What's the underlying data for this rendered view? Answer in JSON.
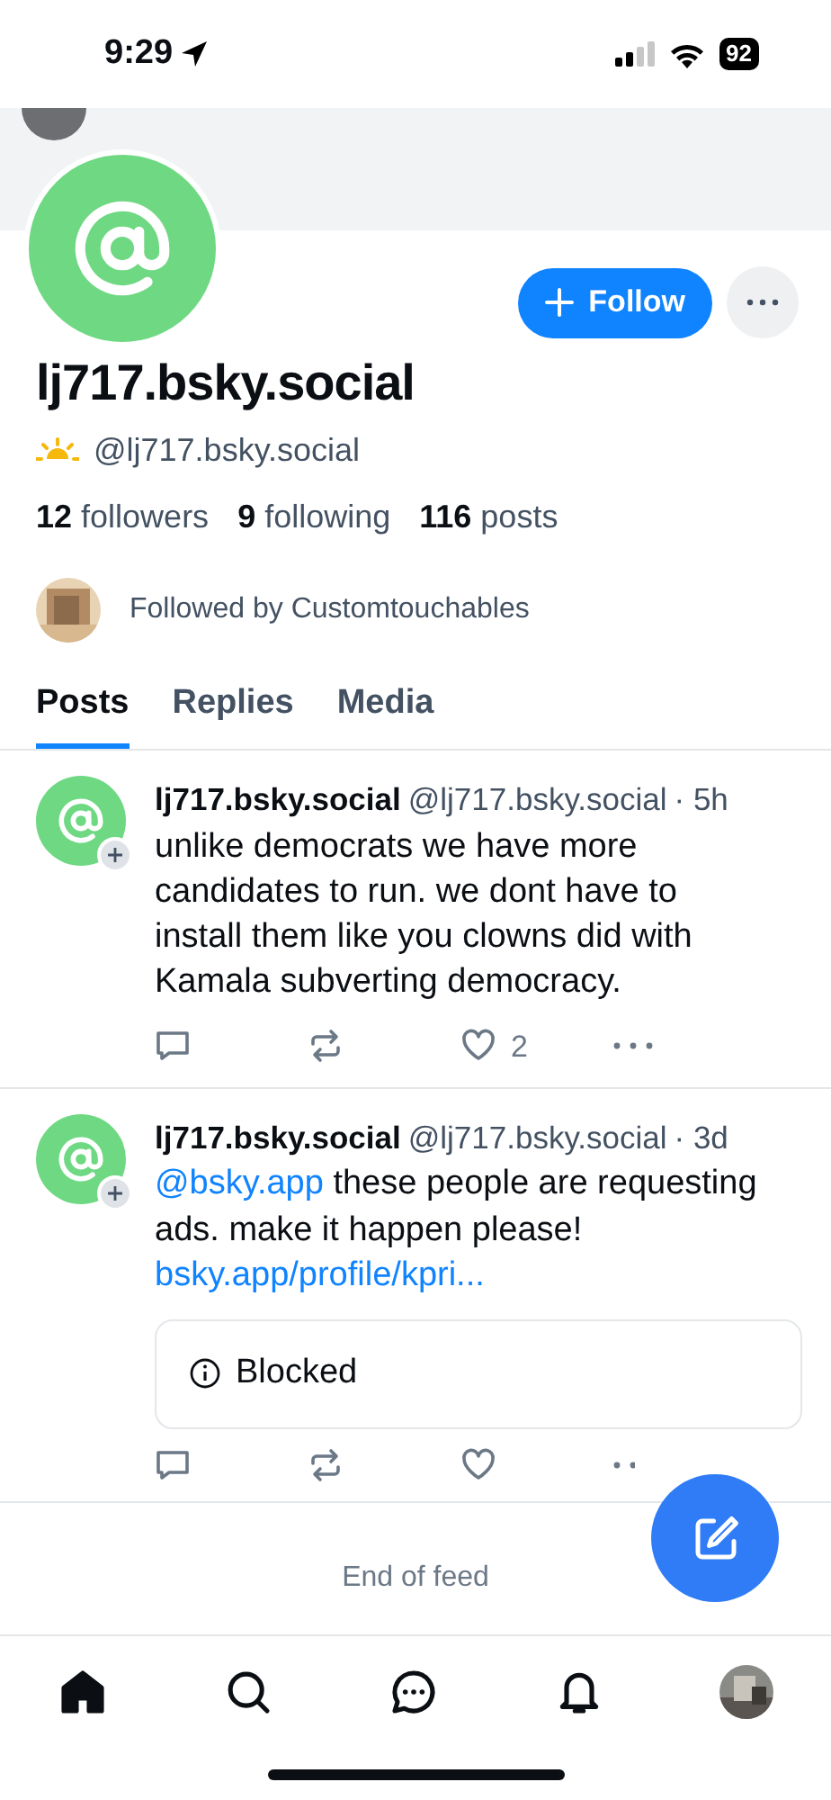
{
  "status_bar": {
    "time": "9:29",
    "battery": "92"
  },
  "profile": {
    "display_name": "lj717.bsky.social",
    "handle": "@lj717.bsky.social",
    "follow_button": "Follow",
    "stats": [
      {
        "count": "12",
        "label": "followers"
      },
      {
        "count": "9",
        "label": "following"
      },
      {
        "count": "116",
        "label": "posts"
      }
    ],
    "followed_by": "Followed by Customtouchables"
  },
  "tabs": [
    {
      "label": "Posts",
      "selected": true
    },
    {
      "label": "Replies",
      "selected": false
    },
    {
      "label": "Media",
      "selected": false
    }
  ],
  "posts": [
    {
      "author": "lj717.bsky.social",
      "handle": "@lj717.bsky.social",
      "time": "· 5h",
      "body": [
        {
          "kind": "text",
          "text": "unlike democrats we have more candidates to run. we dont have to install them like you clowns did with Kamala subverting democracy."
        }
      ],
      "likes": "2"
    },
    {
      "author": "lj717.bsky.social",
      "handle": "@lj717.bsky.social",
      "time": "· 3d",
      "body": [
        {
          "kind": "mention",
          "text": "@bsky.app"
        },
        {
          "kind": "text",
          "text": " these people are requesting ads. make it happen please!"
        },
        {
          "kind": "link",
          "text": "bsky.app/profile/kpri..."
        }
      ],
      "embed": "Blocked"
    }
  ],
  "end_of_feed": "End of feed",
  "nav": [
    {
      "kind": "home",
      "selected": true
    },
    {
      "kind": "search",
      "selected": false
    },
    {
      "kind": "chat",
      "selected": false
    },
    {
      "kind": "notifications",
      "selected": false
    },
    {
      "kind": "profile",
      "selected": false
    }
  ]
}
